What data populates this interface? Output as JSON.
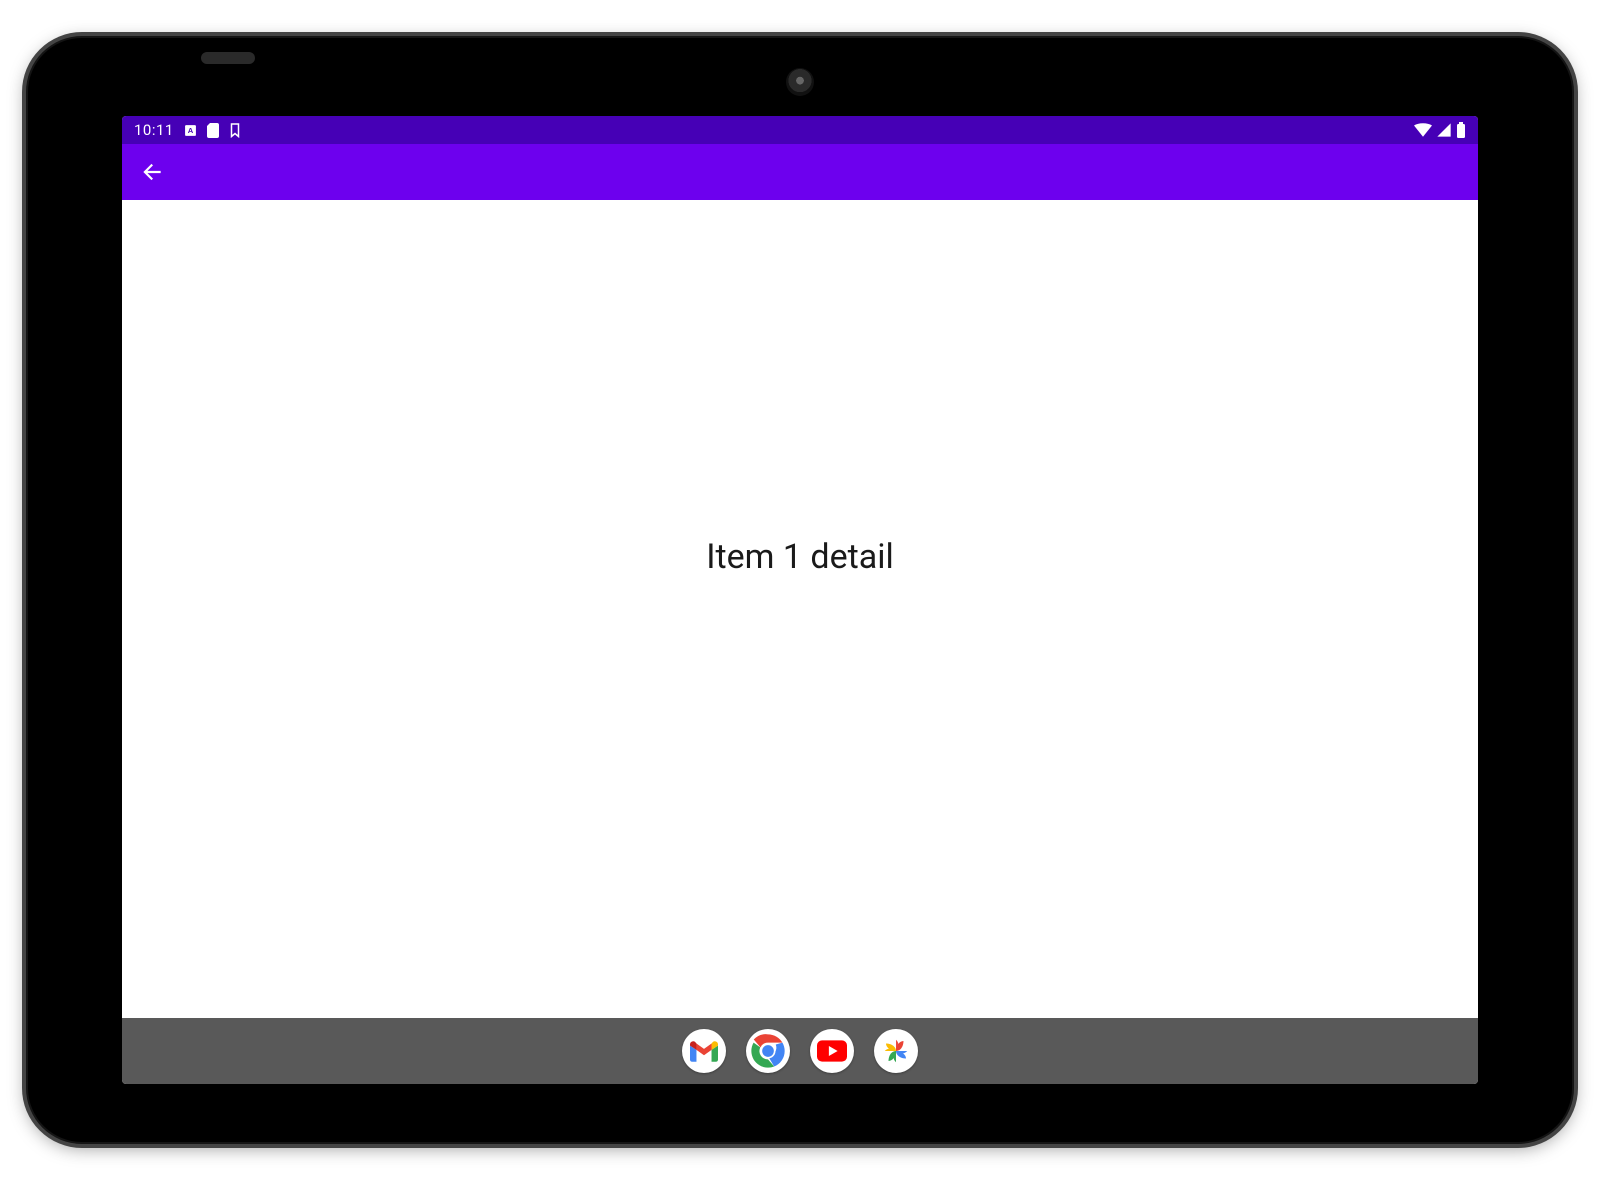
{
  "statusbar": {
    "clock": "10:11",
    "icons_left": [
      "notif-a-icon",
      "sd-card-icon",
      "bookmark-outline-icon"
    ],
    "icons_right": [
      "wifi-icon",
      "signal-icon",
      "battery-icon"
    ],
    "bg_color": "#4600b6"
  },
  "appbar": {
    "bg_color": "#6d00ee",
    "back_icon": "arrow-back-icon"
  },
  "main": {
    "detail_text": "Item 1 detail"
  },
  "taskbar": {
    "bg_color": "#595959",
    "apps": [
      {
        "name": "gmail-icon",
        "label": "Gmail"
      },
      {
        "name": "chrome-icon",
        "label": "Chrome"
      },
      {
        "name": "youtube-icon",
        "label": "YouTube"
      },
      {
        "name": "photos-icon",
        "label": "Photos"
      }
    ]
  }
}
